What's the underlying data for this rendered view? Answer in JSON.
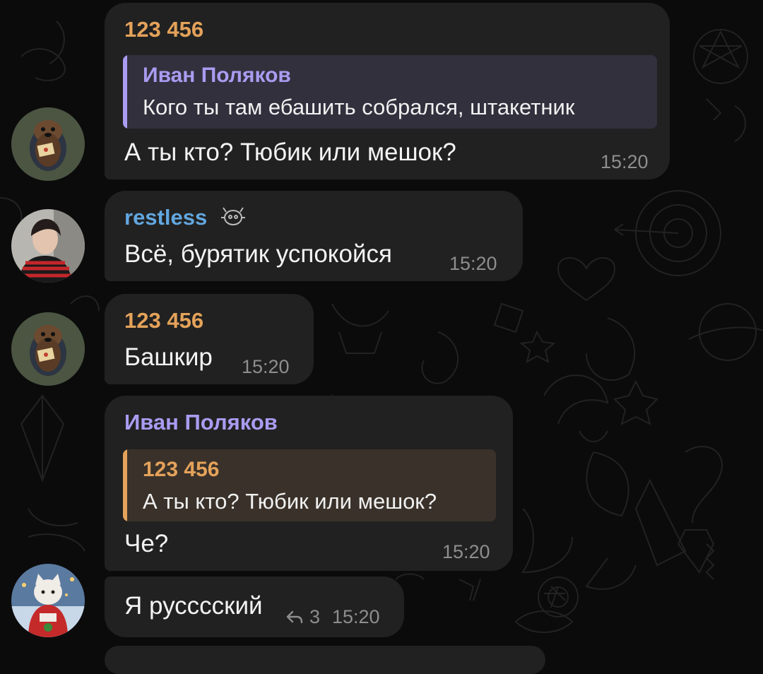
{
  "colors": {
    "name_orange": "#e4a25a",
    "name_purple": "#a99cf1",
    "name_blue": "#62a7e0",
    "bubble": "#212121",
    "quote_purple_bg": "#32303d",
    "quote_orange_bg": "#3a322a"
  },
  "messages": [
    {
      "sender": "123 456",
      "reply": {
        "name": "Иван Поляков",
        "text": "Кого ты там ебашить собрался, штакетник"
      },
      "text": "А ты кто? Тюбик или мешок?",
      "time": "15:20"
    },
    {
      "sender": "restless",
      "text": "Всё, бурятик успокойся",
      "time": "15:20",
      "badge_icon": "animated-emoji-status-icon"
    },
    {
      "sender": "123 456",
      "text": "Башкир",
      "time": "15:20"
    },
    {
      "sender": "Иван Поляков",
      "reply": {
        "name": "123 456",
        "text": "А ты кто? Тюбик или мешок?"
      },
      "text": "Че?",
      "time": "15:20"
    },
    {
      "text": "Я русссский",
      "replies_count": "3",
      "time": "15:20",
      "reply_icon": "reply-arrow-icon"
    }
  ]
}
